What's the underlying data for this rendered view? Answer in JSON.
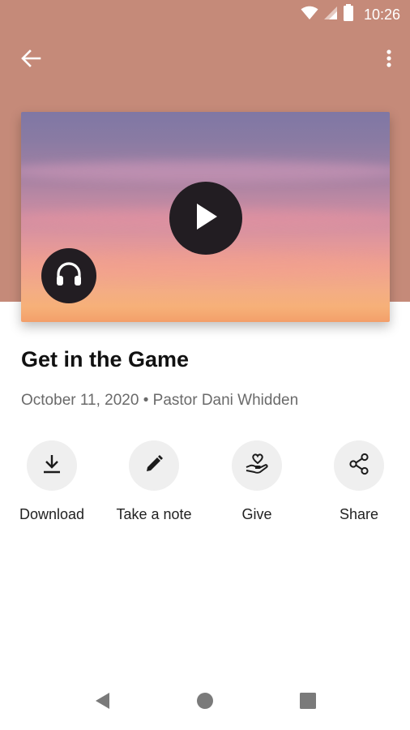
{
  "status_bar": {
    "time": "10:26",
    "icons": [
      "wifi-icon",
      "cell-signal-icon",
      "battery-icon"
    ]
  },
  "app_bar": {
    "back_icon": "arrow-left-icon",
    "menu_icon": "more-vertical-icon"
  },
  "media": {
    "play_icon": "play-icon",
    "audio_icon": "headphones-icon"
  },
  "sermon": {
    "title": "Get in the Game",
    "date": "October 11, 2020",
    "separator": "•",
    "speaker": "Pastor Dani Whidden"
  },
  "actions": [
    {
      "label": "Download",
      "icon": "download-icon"
    },
    {
      "label": "Take a note",
      "icon": "pencil-icon"
    },
    {
      "label": "Give",
      "icon": "heart-hand-icon"
    },
    {
      "label": "Share",
      "icon": "share-icon"
    }
  ],
  "nav_bar": {
    "icons": [
      "nav-back-icon",
      "nav-home-icon",
      "nav-recents-icon"
    ]
  },
  "colors": {
    "header": "#c58a79",
    "button_dark": "#221d22",
    "action_circle": "#efefef"
  }
}
